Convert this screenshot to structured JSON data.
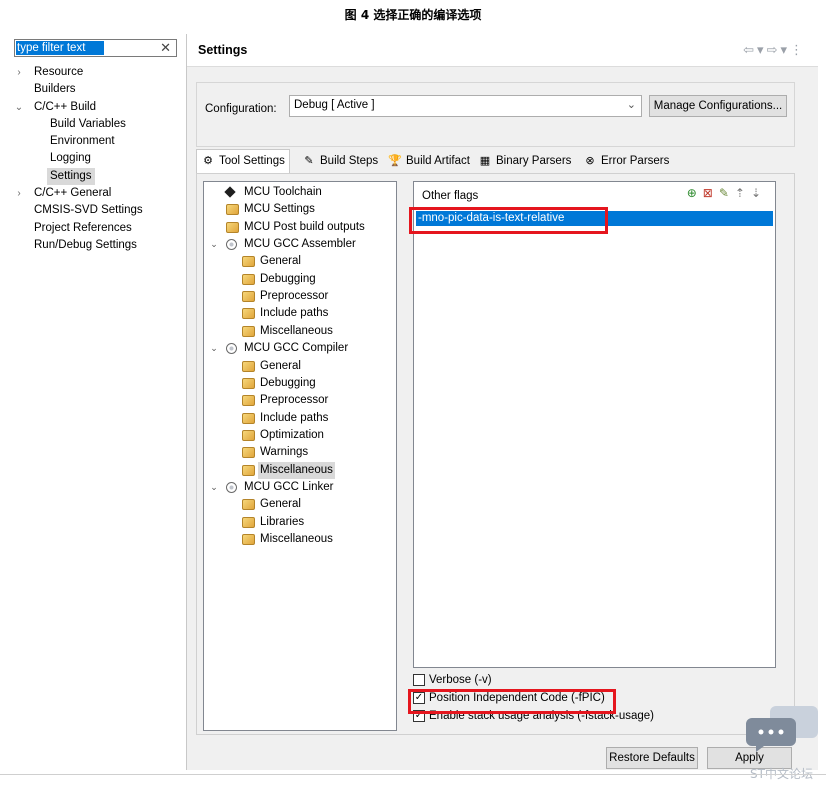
{
  "caption": "图 4 选择正确的编译选项",
  "filter": {
    "value": "type filter text"
  },
  "nav": [
    {
      "label": "Resource",
      "indent": 0,
      "toggle": "›"
    },
    {
      "label": "Builders",
      "indent": 0,
      "toggle": ""
    },
    {
      "label": "C/C++ Build",
      "indent": 0,
      "toggle": "⌄"
    },
    {
      "label": "Build Variables",
      "indent": 1,
      "toggle": ""
    },
    {
      "label": "Environment",
      "indent": 1,
      "toggle": ""
    },
    {
      "label": "Logging",
      "indent": 1,
      "toggle": ""
    },
    {
      "label": "Settings",
      "indent": 1,
      "toggle": "",
      "selected": true
    },
    {
      "label": "C/C++ General",
      "indent": 0,
      "toggle": "›"
    },
    {
      "label": "CMSIS-SVD Settings",
      "indent": 0,
      "toggle": ""
    },
    {
      "label": "Project References",
      "indent": 0,
      "toggle": ""
    },
    {
      "label": "Run/Debug Settings",
      "indent": 0,
      "toggle": ""
    }
  ],
  "settings": {
    "title": "Settings",
    "config_label": "Configuration:",
    "config_value": "Debug  [ Active ]",
    "manage_label": "Manage Configurations..."
  },
  "tabs": [
    {
      "label": "Tool Settings",
      "icon": "tool-settings-icon",
      "glyph": "⚙",
      "active": true
    },
    {
      "label": "Build Steps",
      "icon": "build-steps-icon",
      "glyph": "✎"
    },
    {
      "label": "Build Artifact",
      "icon": "build-artifact-icon",
      "glyph": "🏆"
    },
    {
      "label": "Binary Parsers",
      "icon": "binary-parsers-icon",
      "glyph": "▦"
    },
    {
      "label": "Error Parsers",
      "icon": "error-parsers-icon",
      "glyph": "⊗"
    }
  ],
  "tree": [
    {
      "label": "MCU Toolchain",
      "level": 1,
      "icon": "chip-icon"
    },
    {
      "label": "MCU Settings",
      "level": 1,
      "icon": "settings-icon"
    },
    {
      "label": "MCU Post build outputs",
      "level": 1,
      "icon": "settings-icon"
    },
    {
      "label": "MCU GCC Assembler",
      "level": 1,
      "icon": "tool-icon",
      "expanded": true
    },
    {
      "label": "General",
      "level": 2,
      "icon": "settings-icon"
    },
    {
      "label": "Debugging",
      "level": 2,
      "icon": "settings-icon"
    },
    {
      "label": "Preprocessor",
      "level": 2,
      "icon": "settings-icon"
    },
    {
      "label": "Include paths",
      "level": 2,
      "icon": "settings-icon"
    },
    {
      "label": "Miscellaneous",
      "level": 2,
      "icon": "settings-icon"
    },
    {
      "label": "MCU GCC Compiler",
      "level": 1,
      "icon": "tool-icon",
      "expanded": true
    },
    {
      "label": "General",
      "level": 2,
      "icon": "settings-icon"
    },
    {
      "label": "Debugging",
      "level": 2,
      "icon": "settings-icon"
    },
    {
      "label": "Preprocessor",
      "level": 2,
      "icon": "settings-icon"
    },
    {
      "label": "Include paths",
      "level": 2,
      "icon": "settings-icon"
    },
    {
      "label": "Optimization",
      "level": 2,
      "icon": "settings-icon"
    },
    {
      "label": "Warnings",
      "level": 2,
      "icon": "settings-icon"
    },
    {
      "label": "Miscellaneous",
      "level": 2,
      "icon": "settings-icon",
      "selected": true
    },
    {
      "label": "MCU GCC Linker",
      "level": 1,
      "icon": "tool-icon",
      "expanded": true
    },
    {
      "label": "General",
      "level": 2,
      "icon": "settings-icon"
    },
    {
      "label": "Libraries",
      "level": 2,
      "icon": "settings-icon"
    },
    {
      "label": "Miscellaneous",
      "level": 2,
      "icon": "settings-icon"
    }
  ],
  "flags": {
    "title": "Other flags",
    "items": [
      "-mno-pic-data-is-text-relative"
    ]
  },
  "checkboxes": [
    {
      "label": "Verbose (-v)",
      "checked": false
    },
    {
      "label": "Position Independent Code (-fPIC)",
      "checked": true
    },
    {
      "label": "Enable stack usage analysis (-fstack-usage)",
      "checked": true
    }
  ],
  "buttons": {
    "restore": "Restore Defaults",
    "apply": "Apply"
  },
  "watermark": "ST中文论坛",
  "colors": {
    "selection": "#0078d7",
    "highlight_box": "#e5161e"
  }
}
